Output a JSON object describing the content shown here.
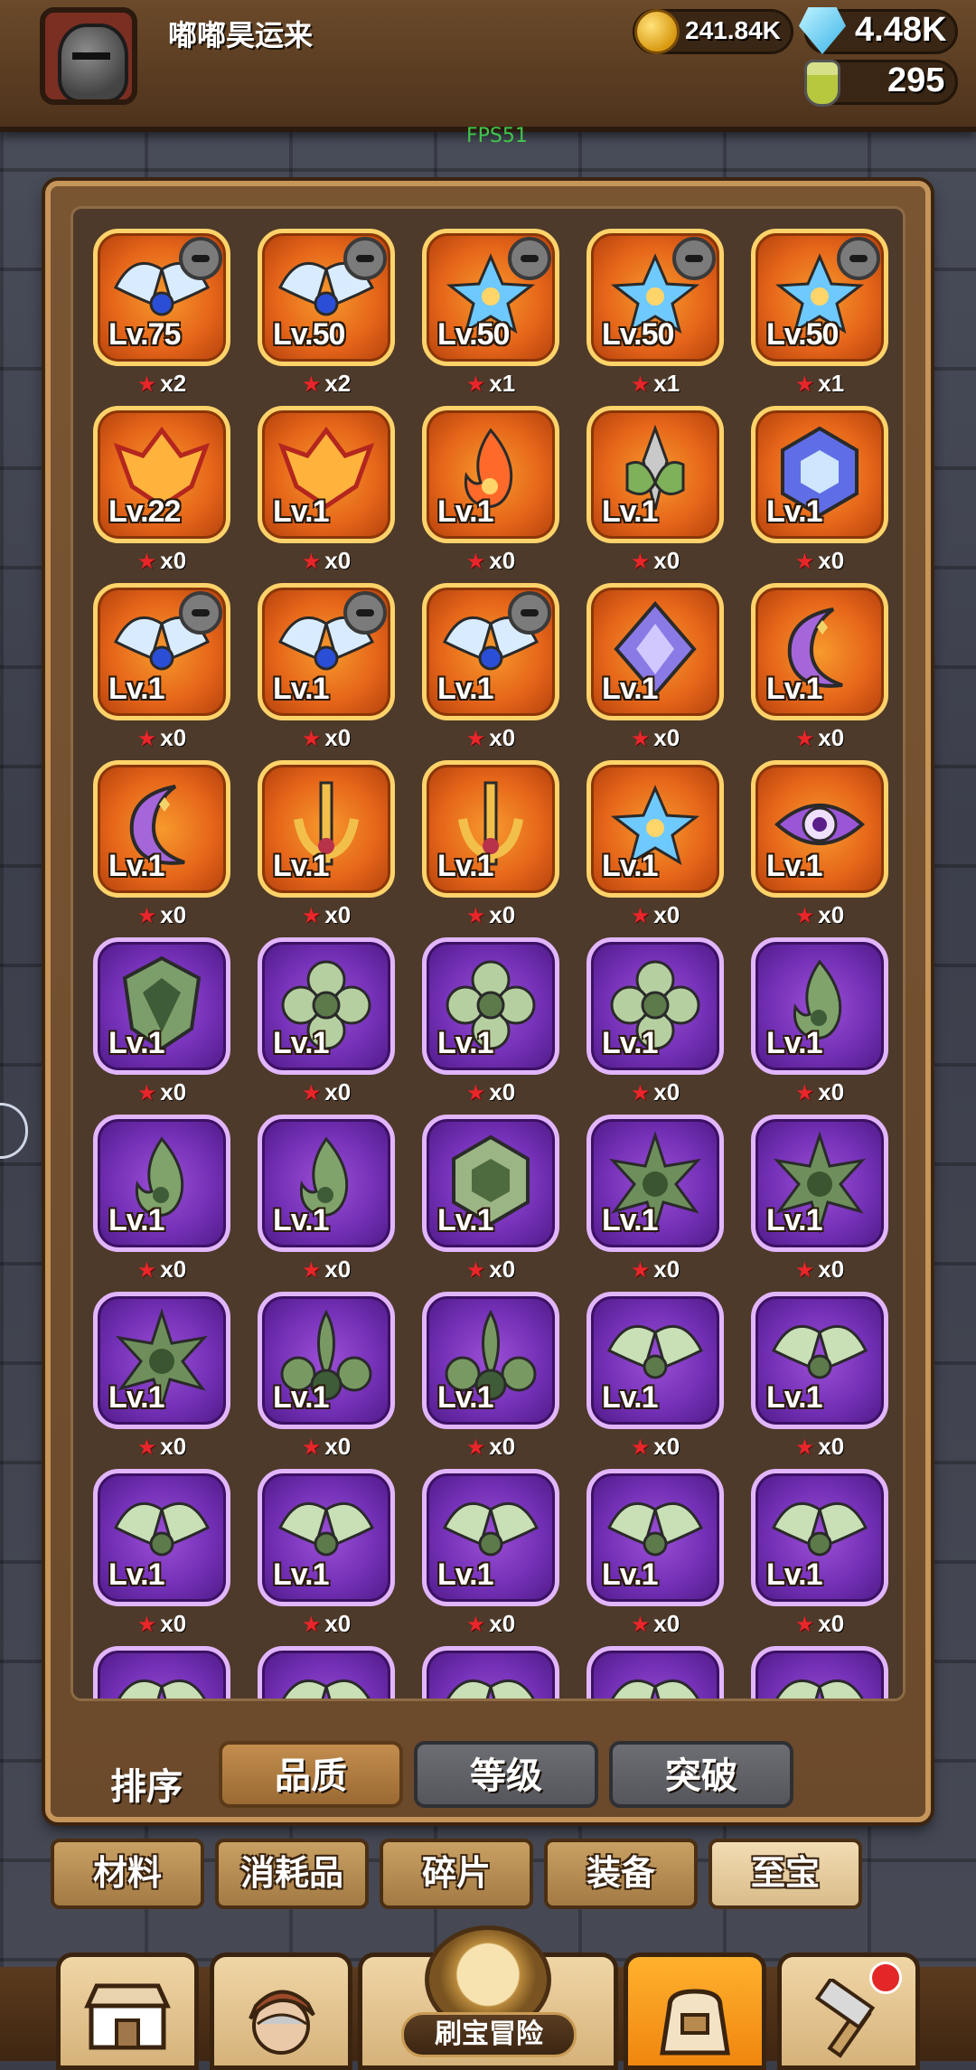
{
  "header": {
    "username": "嘟嘟昊运来",
    "gold": "241.84K",
    "gems": "4.48K",
    "potions": "295",
    "fps": "FPS51",
    "icons": [
      "avatar-helmet",
      "coin-icon",
      "gem-icon",
      "potion-icon"
    ]
  },
  "grid": {
    "rows": [
      [
        {
          "rarity": "orange",
          "art": "wing-emblem",
          "level": "Lv.75",
          "stars": "x2",
          "hero": true
        },
        {
          "rarity": "orange",
          "art": "wing-emblem",
          "level": "Lv.50",
          "stars": "x2",
          "hero": true
        },
        {
          "rarity": "orange",
          "art": "blue-star",
          "level": "Lv.50",
          "stars": "x1",
          "hero": true
        },
        {
          "rarity": "orange",
          "art": "blue-star",
          "level": "Lv.50",
          "stars": "x1",
          "hero": true
        },
        {
          "rarity": "orange",
          "art": "blue-star",
          "level": "Lv.50",
          "stars": "x1",
          "hero": true
        }
      ],
      [
        {
          "rarity": "orange",
          "art": "flame-crest",
          "level": "Lv.22",
          "stars": "x0",
          "hero": false
        },
        {
          "rarity": "orange",
          "art": "flame-crest",
          "level": "Lv.1",
          "stars": "x0",
          "hero": false
        },
        {
          "rarity": "orange",
          "art": "fire",
          "level": "Lv.1",
          "stars": "x0",
          "hero": false
        },
        {
          "rarity": "orange",
          "art": "green-leaf",
          "level": "Lv.1",
          "stars": "x0",
          "hero": false
        },
        {
          "rarity": "orange",
          "art": "blue-hex",
          "level": "Lv.1",
          "stars": "x0",
          "hero": false
        }
      ],
      [
        {
          "rarity": "orange",
          "art": "wing-emblem",
          "level": "Lv.1",
          "stars": "x0",
          "hero": true
        },
        {
          "rarity": "orange",
          "art": "wing-emblem",
          "level": "Lv.1",
          "stars": "x0",
          "hero": true
        },
        {
          "rarity": "orange",
          "art": "wing-emblem",
          "level": "Lv.1",
          "stars": "x0",
          "hero": true
        },
        {
          "rarity": "orange",
          "art": "purple-diamond",
          "level": "Lv.1",
          "stars": "x0",
          "hero": false
        },
        {
          "rarity": "orange",
          "art": "purple-moon",
          "level": "Lv.1",
          "stars": "x0",
          "hero": false
        }
      ],
      [
        {
          "rarity": "orange",
          "art": "purple-moon",
          "level": "Lv.1",
          "stars": "x0",
          "hero": false
        },
        {
          "rarity": "orange",
          "art": "gold-trident",
          "level": "Lv.1",
          "stars": "x0",
          "hero": false
        },
        {
          "rarity": "orange",
          "art": "gold-trident",
          "level": "Lv.1",
          "stars": "x0",
          "hero": false
        },
        {
          "rarity": "orange",
          "art": "blue-star",
          "level": "Lv.1",
          "stars": "x0",
          "hero": false
        },
        {
          "rarity": "orange",
          "art": "purple-eye",
          "level": "Lv.1",
          "stars": "x0",
          "hero": false
        }
      ],
      [
        {
          "rarity": "purple",
          "art": "green-shield",
          "level": "Lv.1",
          "stars": "x0",
          "hero": false
        },
        {
          "rarity": "purple",
          "art": "green-flower",
          "level": "Lv.1",
          "stars": "x0",
          "hero": false
        },
        {
          "rarity": "purple",
          "art": "green-flower",
          "level": "Lv.1",
          "stars": "x0",
          "hero": false
        },
        {
          "rarity": "purple",
          "art": "green-flower",
          "level": "Lv.1",
          "stars": "x0",
          "hero": false
        },
        {
          "rarity": "purple",
          "art": "green-flame",
          "level": "Lv.1",
          "stars": "x0",
          "hero": false
        }
      ],
      [
        {
          "rarity": "purple",
          "art": "green-flame",
          "level": "Lv.1",
          "stars": "x0",
          "hero": false
        },
        {
          "rarity": "purple",
          "art": "green-flame",
          "level": "Lv.1",
          "stars": "x0",
          "hero": false
        },
        {
          "rarity": "purple",
          "art": "green-hex",
          "level": "Lv.1",
          "stars": "x0",
          "hero": false
        },
        {
          "rarity": "purple",
          "art": "green-spike",
          "level": "Lv.1",
          "stars": "x0",
          "hero": false
        },
        {
          "rarity": "purple",
          "art": "green-spike",
          "level": "Lv.1",
          "stars": "x0",
          "hero": false
        }
      ],
      [
        {
          "rarity": "purple",
          "art": "green-spike",
          "level": "Lv.1",
          "stars": "x0",
          "hero": false
        },
        {
          "rarity": "purple",
          "art": "green-fleur",
          "level": "Lv.1",
          "stars": "x0",
          "hero": false
        },
        {
          "rarity": "purple",
          "art": "green-fleur",
          "level": "Lv.1",
          "stars": "x0",
          "hero": false
        },
        {
          "rarity": "purple",
          "art": "green-wing",
          "level": "Lv.1",
          "stars": "x0",
          "hero": false
        },
        {
          "rarity": "purple",
          "art": "green-wing",
          "level": "Lv.1",
          "stars": "x0",
          "hero": false
        }
      ],
      [
        {
          "rarity": "purple",
          "art": "green-wing",
          "level": "Lv.1",
          "stars": "x0",
          "hero": false
        },
        {
          "rarity": "purple",
          "art": "green-wing",
          "level": "Lv.1",
          "stars": "x0",
          "hero": false
        },
        {
          "rarity": "purple",
          "art": "green-wing",
          "level": "Lv.1",
          "stars": "x0",
          "hero": false
        },
        {
          "rarity": "purple",
          "art": "green-wing",
          "level": "Lv.1",
          "stars": "x0",
          "hero": false
        },
        {
          "rarity": "purple",
          "art": "green-wing",
          "level": "Lv.1",
          "stars": "x0",
          "hero": false
        }
      ],
      [
        {
          "rarity": "purple",
          "art": "green-wing",
          "level": "",
          "stars": "",
          "hero": false
        },
        {
          "rarity": "purple",
          "art": "green-wing",
          "level": "",
          "stars": "",
          "hero": false
        },
        {
          "rarity": "purple",
          "art": "green-wing",
          "level": "",
          "stars": "",
          "hero": false
        },
        {
          "rarity": "purple",
          "art": "green-wing",
          "level": "",
          "stars": "",
          "hero": false
        },
        {
          "rarity": "purple",
          "art": "green-wing",
          "level": "",
          "stars": "",
          "hero": false
        }
      ]
    ]
  },
  "sort": {
    "label": "排序",
    "options": [
      "品质",
      "等级",
      "突破"
    ],
    "active_index": 0
  },
  "categories": {
    "tabs": [
      "材料",
      "消耗品",
      "碎片",
      "装备",
      "至宝"
    ],
    "active_index": 4
  },
  "bottom_nav": {
    "items": [
      "shop-icon",
      "hero-icon",
      "adventure-icon",
      "bag-icon",
      "forge-icon"
    ],
    "center_label": "刷宝冒险",
    "active_index": 3
  },
  "colors": {
    "orange_frame": "#ffd36a",
    "purple_frame": "#e2b6ff",
    "star": "#e8262a",
    "active_nav": "#f0860f"
  }
}
